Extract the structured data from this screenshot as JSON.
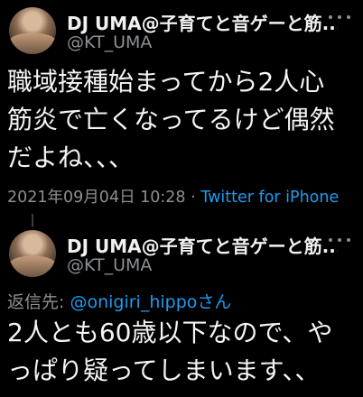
{
  "tweet1": {
    "display_name": "DJ UMA@子育てと音ゲーと筋...",
    "handle": "@KT_UMA",
    "text_lines": [
      "職域接種始まってから2人心",
      "筋炎で亡くなってるけど偶然",
      "だよね、、、"
    ],
    "timestamp": "2021年09月04日 10:28",
    "separator": "·",
    "source": "Twitter for iPhone",
    "avatar_icon": "profile-photo-avatar",
    "more_icon": "more-dots-icon"
  },
  "tweet2": {
    "display_name": "DJ UMA@子育てと音ゲーと筋...",
    "handle": "@KT_UMA",
    "reply_prefix": "返信先: ",
    "reply_mention": "@onigiri_hippoさん",
    "text_lines": [
      "2人とも60歳以下なので、や",
      "っぱり疑ってしまいます、、"
    ],
    "avatar_icon": "profile-photo-avatar",
    "more_icon": "more-dots-icon"
  },
  "colors": {
    "background": "#000000",
    "text": "#e7e9ea",
    "secondary": "#8b9095",
    "link": "#1d9bf0"
  }
}
